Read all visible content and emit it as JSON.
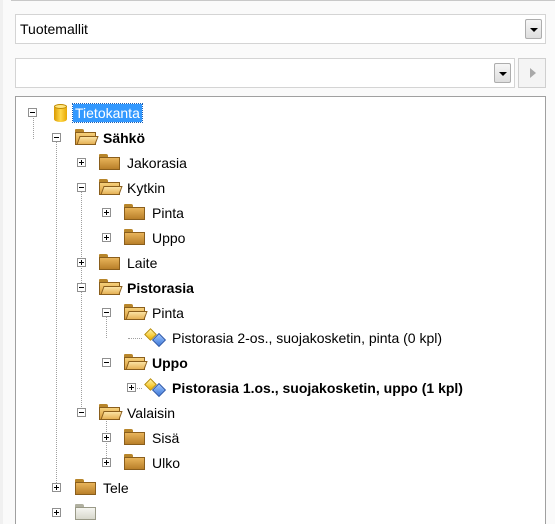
{
  "model_select": {
    "value": "Tuotemallit"
  },
  "search_select": {
    "value": ""
  },
  "tree": {
    "root": {
      "label": "Tietokanta"
    },
    "sahko": {
      "label": "Sähkö"
    },
    "jakorasia": {
      "label": "Jakorasia"
    },
    "kytkin": {
      "label": "Kytkin"
    },
    "kytkin_pinta": {
      "label": "Pinta"
    },
    "kytkin_uppo": {
      "label": "Uppo"
    },
    "laite": {
      "label": "Laite"
    },
    "pistorasia": {
      "label": "Pistorasia"
    },
    "pistorasia_pinta": {
      "label": "Pinta"
    },
    "item_pinta": {
      "label": "Pistorasia 2-os., suojakosketin, pinta (0 kpl)"
    },
    "pistorasia_uppo": {
      "label": "Uppo"
    },
    "item_uppo": {
      "label": "Pistorasia 1.os., suojakosketin, uppo (1 kpl)"
    },
    "valaisin": {
      "label": "Valaisin"
    },
    "valaisin_sisa": {
      "label": "Sisä"
    },
    "valaisin_ulko": {
      "label": "Ulko"
    },
    "tele": {
      "label": "Tele"
    }
  },
  "colors": {
    "selection": "#3399ff",
    "folder": "#e0a94a"
  }
}
